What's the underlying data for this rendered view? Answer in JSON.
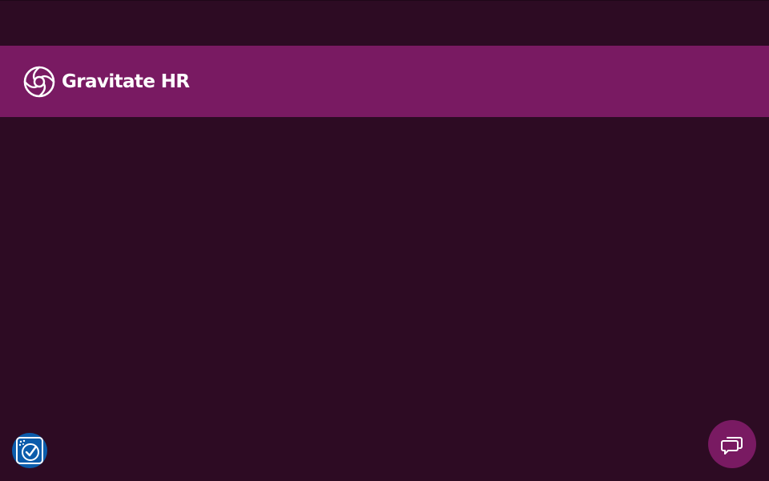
{
  "header": {
    "brand_name": "Gravitate HR",
    "logo_icon": "gravitate-orbit-logo-icon"
  },
  "widgets": {
    "accessibility_icon": "accessibility-check-icon",
    "chat_icon": "chat-bubbles-icon"
  },
  "colors": {
    "background": "#2d0b23",
    "brand_bar": "#791a62",
    "chat_button": "#791a62",
    "accessibility_badge": "#0b5cab",
    "text": "#ffffff"
  }
}
